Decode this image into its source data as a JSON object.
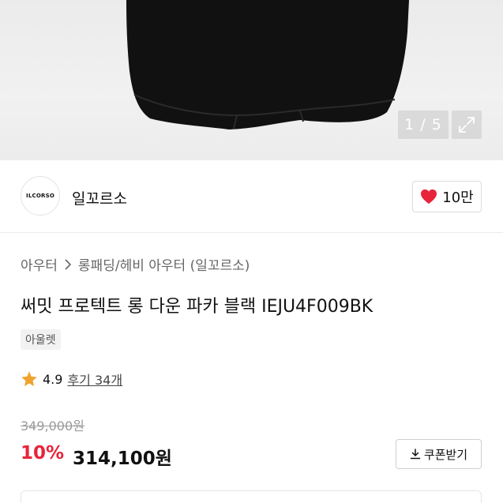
{
  "gallery": {
    "counter": "1 / 5"
  },
  "seller": {
    "logo_text": "ILCORSO",
    "name": "일꼬르소",
    "likes": "10만"
  },
  "breadcrumb": {
    "category": "아우터",
    "subcategory": "롱패딩/헤비 아우터 (일꼬르소)"
  },
  "product": {
    "title": "써밋 프로텍트 롱 다운 파카 블랙 IEJU4F009BK",
    "tag": "아울렛",
    "rating": "4.9",
    "reviews": "후기 34개",
    "original_price": "349,000원",
    "discount": "10%",
    "sale_price": "314,100원"
  },
  "coupon": {
    "label": "쿠폰받기"
  },
  "colors": {
    "heart": "#e8243a",
    "star": "#f0a32e",
    "discount": "#e8243a"
  },
  "icons": [
    "expand-icon",
    "heart-icon",
    "star-icon",
    "download-icon"
  ]
}
